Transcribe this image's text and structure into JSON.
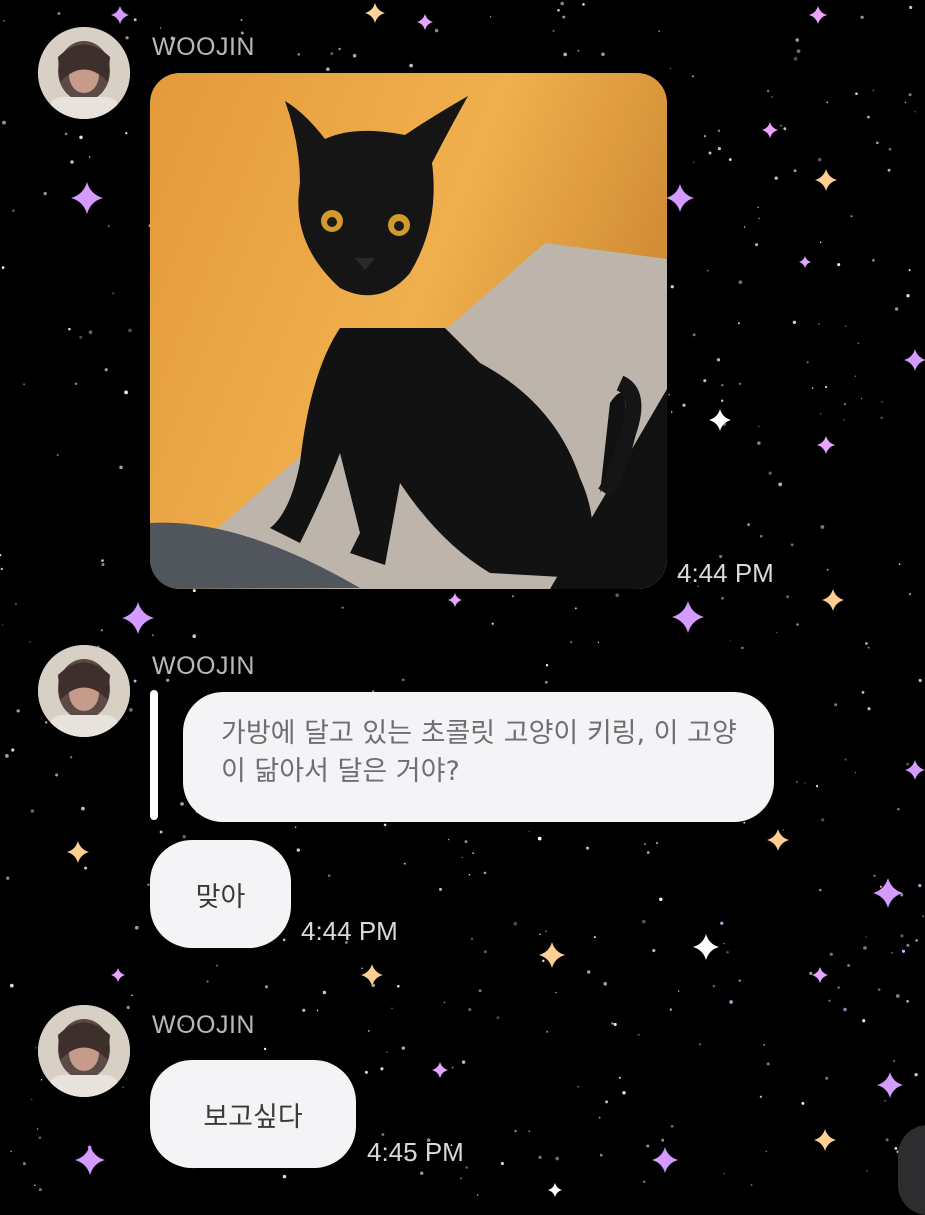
{
  "chat": {
    "messages": [
      {
        "sender": "WOOJIN",
        "type": "image",
        "image_subject": "black-cat-photo",
        "time": "4:44 PM"
      },
      {
        "sender": "WOOJIN",
        "type": "reply",
        "quoted_text": "가방에 달고 있는 초콜릿 고양이 키링, 이 고양이 닮아서 달은 거야?",
        "text": "맞아",
        "time": "4:44 PM"
      },
      {
        "sender": "WOOJIN",
        "type": "text",
        "text": "보고싶다",
        "time": "4:45 PM"
      }
    ]
  },
  "colors": {
    "background": "#000000",
    "bubble": "#f4f4f6",
    "sender_name": "#b9b9b9",
    "timestamp": "#d9d9d9"
  }
}
